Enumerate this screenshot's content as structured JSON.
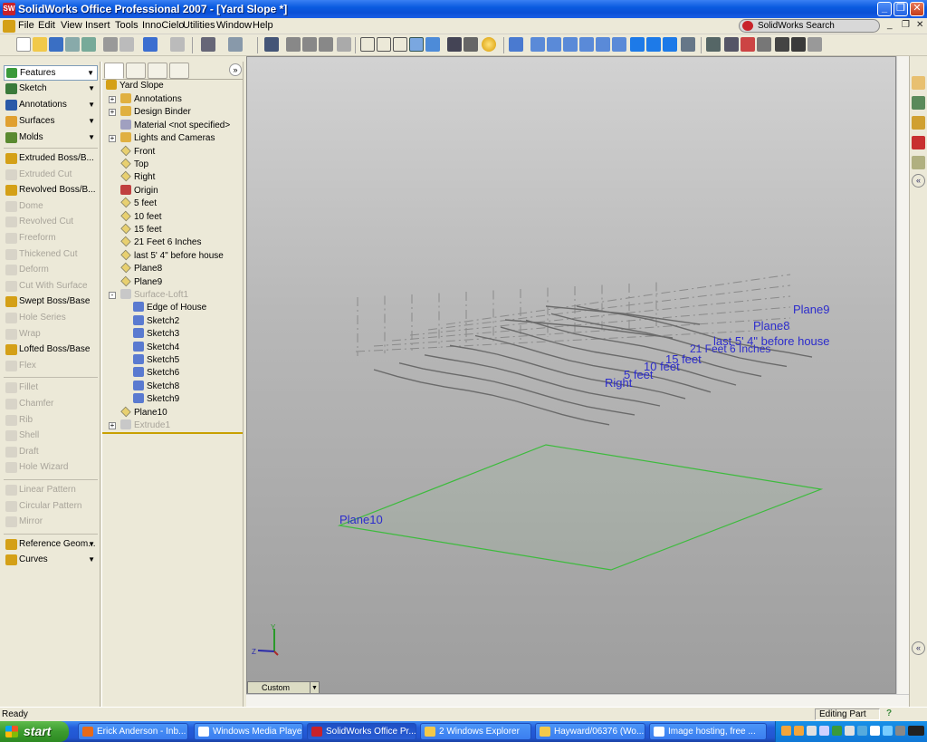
{
  "window": {
    "title": "SolidWorks Office Professional 2007 - [Yard Slope *]"
  },
  "menu": [
    "File",
    "Edit",
    "View",
    "Insert",
    "Tools",
    "InnoCielo",
    "Utilities",
    "Window",
    "Help"
  ],
  "search": {
    "label": "SolidWorks Search"
  },
  "command_manager": {
    "selected": "Features",
    "groups": [
      {
        "label": "Sketch",
        "icon": "sketch-icon"
      },
      {
        "label": "Annotations",
        "icon": "annotations-icon"
      },
      {
        "label": "Surfaces",
        "icon": "surfaces-icon"
      },
      {
        "label": "Molds",
        "icon": "molds-icon"
      }
    ],
    "features": [
      {
        "label": "Extruded Boss/B...",
        "enabled": true
      },
      {
        "label": "Extruded Cut",
        "enabled": false
      },
      {
        "label": "Revolved Boss/B...",
        "enabled": true
      },
      {
        "label": "Dome",
        "enabled": false
      },
      {
        "label": "Revolved Cut",
        "enabled": false
      },
      {
        "label": "Freeform",
        "enabled": false
      },
      {
        "label": "Thickened Cut",
        "enabled": false
      },
      {
        "label": "Deform",
        "enabled": false
      },
      {
        "label": "Cut With Surface",
        "enabled": false
      },
      {
        "label": "Swept Boss/Base",
        "enabled": true
      },
      {
        "label": "Hole Series",
        "enabled": false
      },
      {
        "label": "Wrap",
        "enabled": false
      },
      {
        "label": "Lofted Boss/Base",
        "enabled": true
      },
      {
        "label": "Flex",
        "enabled": false
      },
      {
        "label": "Fillet",
        "enabled": false
      },
      {
        "label": "Chamfer",
        "enabled": false
      },
      {
        "label": "Rib",
        "enabled": false
      },
      {
        "label": "Shell",
        "enabled": false
      },
      {
        "label": "Draft",
        "enabled": false
      },
      {
        "label": "Hole Wizard",
        "enabled": false
      },
      {
        "label": "Linear Pattern",
        "enabled": false
      },
      {
        "label": "Circular Pattern",
        "enabled": false
      },
      {
        "label": "Mirror",
        "enabled": false
      },
      {
        "label": "Reference Geom...",
        "enabled": true
      },
      {
        "label": "Curves",
        "enabled": true
      }
    ]
  },
  "feature_tree": {
    "root": "Yard Slope",
    "items": [
      {
        "label": "Annotations",
        "expander": "+",
        "indent": 1,
        "icon": "annotations-folder-icon",
        "dim": false
      },
      {
        "label": "Design Binder",
        "expander": "+",
        "indent": 1,
        "icon": "design-binder-icon",
        "dim": false
      },
      {
        "label": "Material <not specified>",
        "expander": "",
        "indent": 1,
        "icon": "material-icon",
        "dim": false
      },
      {
        "label": "Lights and Cameras",
        "expander": "+",
        "indent": 1,
        "icon": "lights-icon",
        "dim": false
      },
      {
        "label": "Front",
        "expander": "",
        "indent": 1,
        "icon": "plane-icon",
        "dim": false
      },
      {
        "label": "Top",
        "expander": "",
        "indent": 1,
        "icon": "plane-icon",
        "dim": false
      },
      {
        "label": "Right",
        "expander": "",
        "indent": 1,
        "icon": "plane-icon",
        "dim": false
      },
      {
        "label": "Origin",
        "expander": "",
        "indent": 1,
        "icon": "origin-icon",
        "dim": false
      },
      {
        "label": "5 feet",
        "expander": "",
        "indent": 1,
        "icon": "plane-icon",
        "dim": false
      },
      {
        "label": "10 feet",
        "expander": "",
        "indent": 1,
        "icon": "plane-icon",
        "dim": false
      },
      {
        "label": "15 feet",
        "expander": "",
        "indent": 1,
        "icon": "plane-icon",
        "dim": false
      },
      {
        "label": "21 Feet 6 Inches",
        "expander": "",
        "indent": 1,
        "icon": "plane-icon",
        "dim": false
      },
      {
        "label": "last 5' 4\" before house",
        "expander": "",
        "indent": 1,
        "icon": "plane-icon",
        "dim": false
      },
      {
        "label": "Plane8",
        "expander": "",
        "indent": 1,
        "icon": "plane-icon",
        "dim": false
      },
      {
        "label": "Plane9",
        "expander": "",
        "indent": 1,
        "icon": "plane-icon",
        "dim": false
      },
      {
        "label": "Surface-Loft1",
        "expander": "-",
        "indent": 1,
        "icon": "surface-loft-icon",
        "dim": true
      },
      {
        "label": "Edge of House",
        "expander": "",
        "indent": 2,
        "icon": "sketch-icon",
        "dim": false
      },
      {
        "label": "Sketch2",
        "expander": "",
        "indent": 2,
        "icon": "sketch-icon",
        "dim": false
      },
      {
        "label": "Sketch3",
        "expander": "",
        "indent": 2,
        "icon": "sketch-icon",
        "dim": false
      },
      {
        "label": "Sketch4",
        "expander": "",
        "indent": 2,
        "icon": "sketch-icon",
        "dim": false
      },
      {
        "label": "Sketch5",
        "expander": "",
        "indent": 2,
        "icon": "sketch-icon",
        "dim": false
      },
      {
        "label": "Sketch6",
        "expander": "",
        "indent": 2,
        "icon": "sketch-icon",
        "dim": false
      },
      {
        "label": "Sketch8",
        "expander": "",
        "indent": 2,
        "icon": "sketch-icon",
        "dim": false
      },
      {
        "label": "Sketch9",
        "expander": "",
        "indent": 2,
        "icon": "sketch-icon",
        "dim": false
      },
      {
        "label": "Plane10",
        "expander": "",
        "indent": 1,
        "icon": "plane-icon",
        "dim": false
      },
      {
        "label": "Extrude1",
        "expander": "+",
        "indent": 1,
        "icon": "extrude-icon",
        "dim": true
      }
    ]
  },
  "viewport": {
    "plane_labels": [
      {
        "text": "Plane9",
        "name": "plane9-label"
      },
      {
        "text": "Plane8",
        "name": "plane8-label"
      },
      {
        "text": "last 5' 4\" before house",
        "name": "last-5-4-label"
      },
      {
        "text": "21 Feet 6 Inches",
        "name": "21-feet-6-inches-label"
      },
      {
        "text": "15 feet",
        "name": "15-feet-label"
      },
      {
        "text": "10 feet",
        "name": "10-feet-label"
      },
      {
        "text": "5 feet",
        "name": "5-feet-label"
      },
      {
        "text": "Right",
        "name": "right-label"
      },
      {
        "text": "Plane10",
        "name": "plane10-label"
      }
    ],
    "view_orientation": "Custom",
    "axis_labels": {
      "y": "Y",
      "z": "Z"
    },
    "colors": {
      "plane_label": "#2c2ccc",
      "plane10_outline": "#3dbb3d",
      "sketch": "#6a6a6a"
    }
  },
  "status": {
    "left": "Ready",
    "mode": "Editing Part",
    "help": "?"
  },
  "taskbar": {
    "start": "start",
    "tasks": [
      {
        "label": "Erick Anderson - Inb...",
        "icon_color": "#e86a1a",
        "active": false
      },
      {
        "label": "Windows Media Player",
        "icon_color": "#ffffff",
        "active": false
      },
      {
        "label": "SolidWorks Office Pr...",
        "icon_color": "#c8222a",
        "active": true
      },
      {
        "label": "2 Windows Explorer",
        "icon_color": "#f3c94a",
        "active": false
      },
      {
        "label": "Hayward/06376 (Wo...",
        "icon_color": "#f3c94a",
        "active": false
      },
      {
        "label": "Image hosting, free ...",
        "icon_color": "#ffffff",
        "active": false
      }
    ]
  }
}
